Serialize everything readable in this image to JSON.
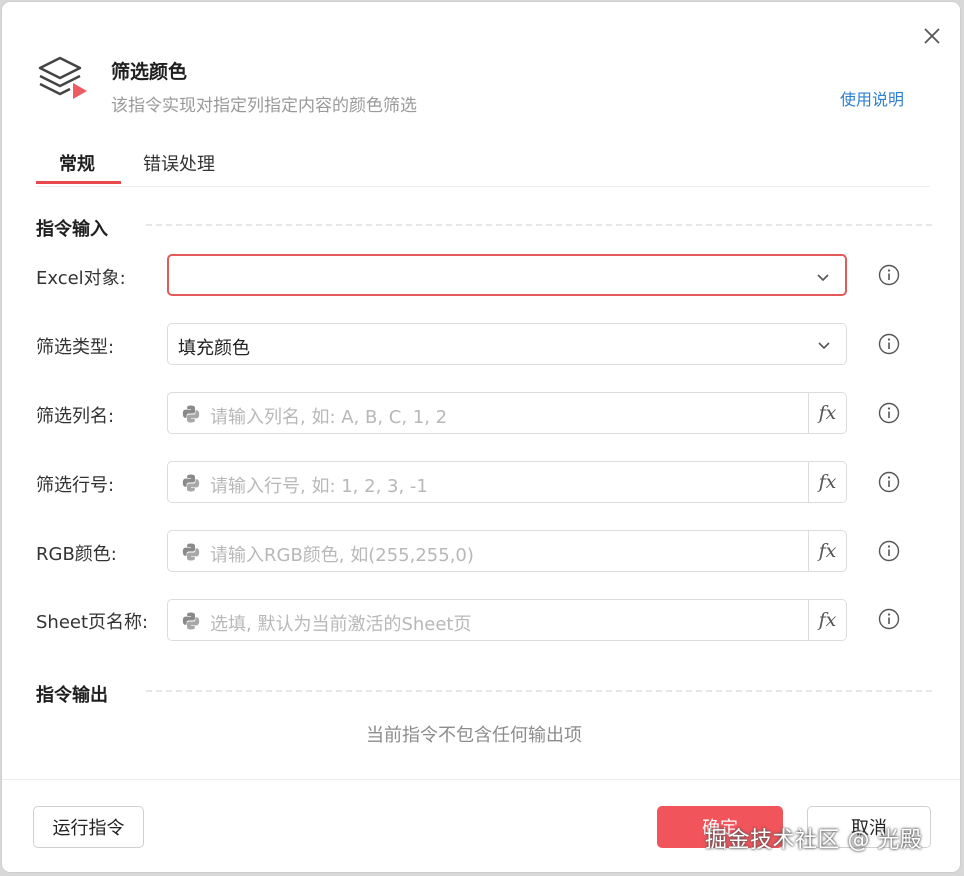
{
  "dialog": {
    "title": "筛选颜色",
    "subtitle": "该指令实现对指定列指定内容的颜色筛选",
    "help_link": "使用说明",
    "icon": "layers-play-icon"
  },
  "tabs": [
    {
      "label": "常规",
      "active": true
    },
    {
      "label": "错误处理",
      "active": false
    }
  ],
  "sections": {
    "input_title": "指令输入",
    "output_title": "指令输出",
    "no_output": "当前指令不包含任何输出项"
  },
  "fields": {
    "excel_object": {
      "label": "Excel对象:",
      "value": "",
      "type": "select",
      "state": "error"
    },
    "filter_type": {
      "label": "筛选类型:",
      "value": "填充颜色",
      "type": "select"
    },
    "column_name": {
      "label": "筛选列名:",
      "placeholder": "请输入列名, 如: A, B, C, 1, 2",
      "type": "expression"
    },
    "row_number": {
      "label": "筛选行号:",
      "placeholder": "请输入行号, 如: 1, 2, 3, -1",
      "type": "expression"
    },
    "rgb_color": {
      "label": "RGB颜色:",
      "placeholder": "请输入RGB颜色, 如(255,255,0)",
      "type": "expression"
    },
    "sheet_name": {
      "label": "Sheet页名称:",
      "placeholder": "选填, 默认为当前激活的Sheet页",
      "type": "expression"
    }
  },
  "fx_label": "fx",
  "footer": {
    "run_button": "运行指令",
    "ok_button": "确定",
    "cancel_button": "取消"
  },
  "watermark": "掘金技术社区 @ 光殿",
  "colors": {
    "accent": "#e8474c",
    "primary_button": "#f2545b",
    "link": "#2f7fd1",
    "error_border": "#e35a5a"
  }
}
